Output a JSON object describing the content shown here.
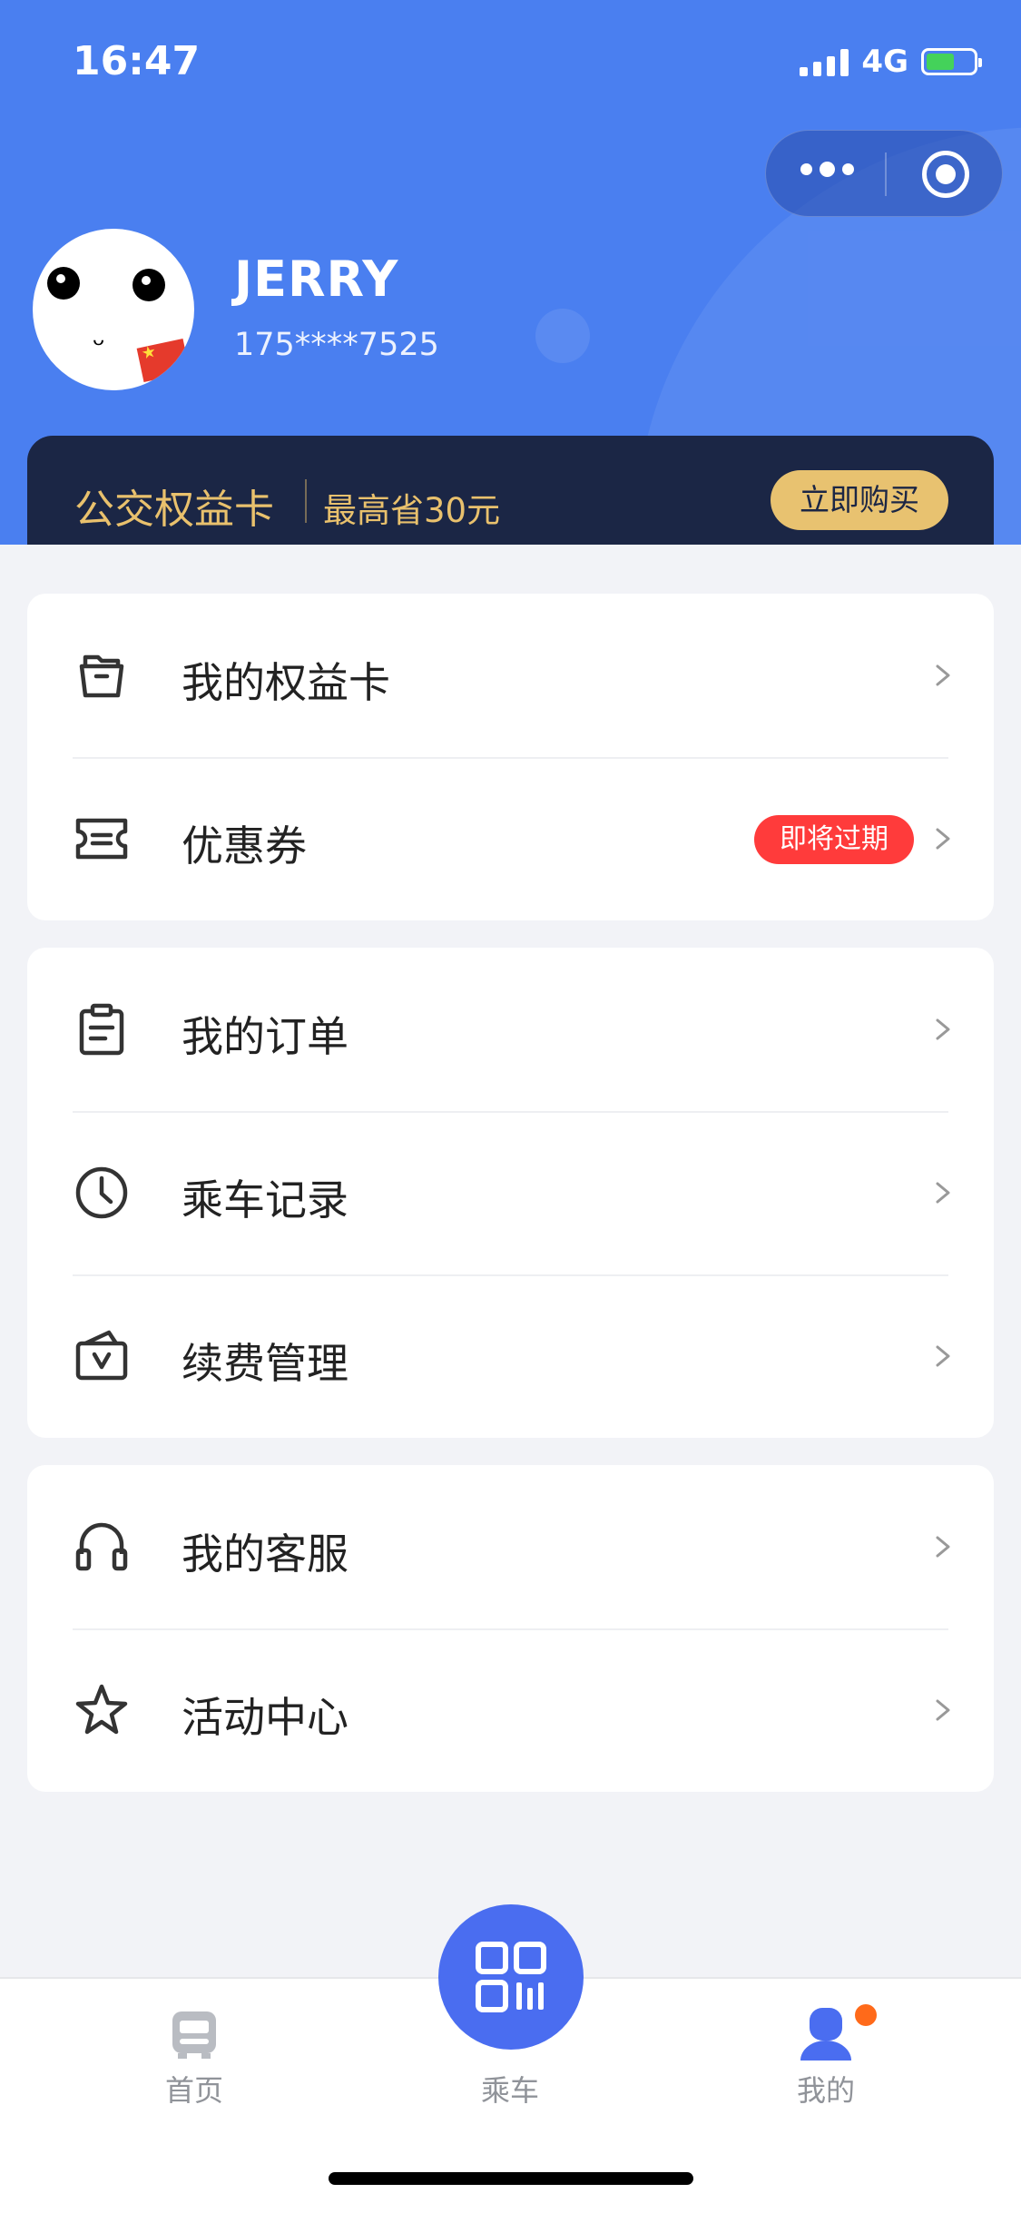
{
  "status_bar": {
    "time": "16:47",
    "network": "4G"
  },
  "user": {
    "name": "JERRY",
    "phone": "175****7525"
  },
  "promo": {
    "title": "公交权益卡",
    "subtitle": "最高省30元",
    "button": "立即购买",
    "accent": "#e9c16d"
  },
  "groups": [
    {
      "items": [
        {
          "label": "我的权益卡",
          "icon": "folder-icon"
        },
        {
          "label": "优惠券",
          "icon": "ticket-icon",
          "badge": "即将过期"
        }
      ]
    },
    {
      "items": [
        {
          "label": "我的订单",
          "icon": "clipboard-icon"
        },
        {
          "label": "乘车记录",
          "icon": "clock-icon"
        },
        {
          "label": "续费管理",
          "icon": "wallet-icon"
        }
      ]
    },
    {
      "items": [
        {
          "label": "我的客服",
          "icon": "headset-icon"
        },
        {
          "label": "活动中心",
          "icon": "star-icon"
        }
      ]
    }
  ],
  "tabbar": {
    "tabs": [
      {
        "label": "首页",
        "icon": "bus-icon"
      },
      {
        "label": "乘车",
        "icon": "qr-code-icon"
      },
      {
        "label": "我的",
        "icon": "user-icon",
        "active": true
      }
    ]
  },
  "colors": {
    "header_blue": "#4a7ff0",
    "tab_active": "#4a6df0",
    "badge_red": "#ff3b3b",
    "promo_bg": "#1b2645"
  }
}
